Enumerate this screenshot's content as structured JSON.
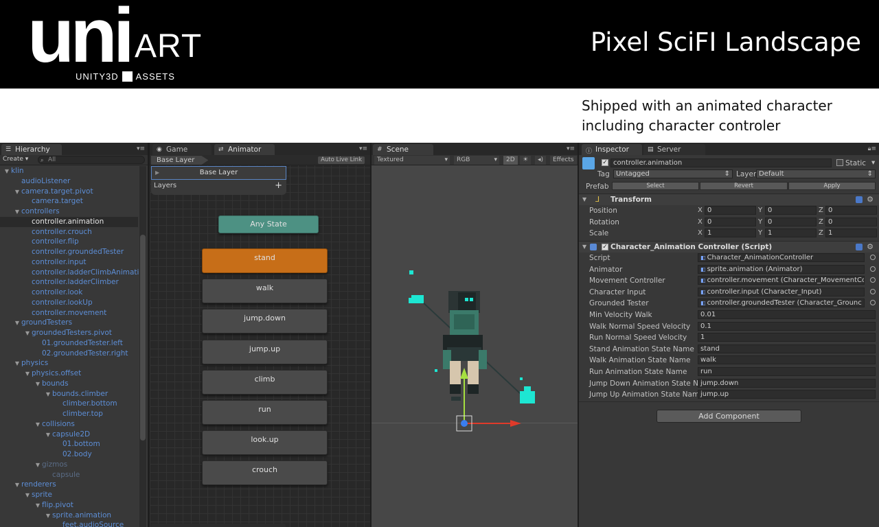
{
  "banner": {
    "logo_main": "uni",
    "logo_art": "ART",
    "logo_left": "UNITY3D",
    "logo_right": "ASSETS",
    "title": "Pixel SciFI Landscape"
  },
  "tagline": {
    "line1": "Shipped with an animated character",
    "line2": "including character controler"
  },
  "hierarchy": {
    "tab": "Hierarchy",
    "create": "Create ▾",
    "search_placeholder": "All",
    "items": [
      {
        "label": "klin",
        "depth": 0,
        "arrow": true
      },
      {
        "label": "audioListener",
        "depth": 1,
        "arrow": false
      },
      {
        "label": "camera.target.pivot",
        "depth": 1,
        "arrow": true
      },
      {
        "label": "camera.target",
        "depth": 2,
        "arrow": false
      },
      {
        "label": "controllers",
        "depth": 1,
        "arrow": true
      },
      {
        "label": "controller.animation",
        "depth": 2,
        "arrow": false,
        "selected": true
      },
      {
        "label": "controller.crouch",
        "depth": 2,
        "arrow": false
      },
      {
        "label": "controller.flip",
        "depth": 2,
        "arrow": false
      },
      {
        "label": "controller.groundedTester",
        "depth": 2,
        "arrow": false
      },
      {
        "label": "controller.input",
        "depth": 2,
        "arrow": false
      },
      {
        "label": "controller.ladderClimbAnimatio",
        "depth": 2,
        "arrow": false
      },
      {
        "label": "controller.ladderClimber",
        "depth": 2,
        "arrow": false
      },
      {
        "label": "controller.look",
        "depth": 2,
        "arrow": false
      },
      {
        "label": "controller.lookUp",
        "depth": 2,
        "arrow": false
      },
      {
        "label": "controller.movement",
        "depth": 2,
        "arrow": false
      },
      {
        "label": "groundTesters",
        "depth": 1,
        "arrow": true
      },
      {
        "label": "groundedTesters.pivot",
        "depth": 2,
        "arrow": true
      },
      {
        "label": "01.groundedTester.left",
        "depth": 3,
        "arrow": false
      },
      {
        "label": "02.groundedTester.right",
        "depth": 3,
        "arrow": false
      },
      {
        "label": "physics",
        "depth": 1,
        "arrow": true
      },
      {
        "label": "physics.offset",
        "depth": 2,
        "arrow": true
      },
      {
        "label": "bounds",
        "depth": 3,
        "arrow": true
      },
      {
        "label": "bounds.climber",
        "depth": 4,
        "arrow": true
      },
      {
        "label": "climber.bottom",
        "depth": 5,
        "arrow": false
      },
      {
        "label": "climber.top",
        "depth": 5,
        "arrow": false
      },
      {
        "label": "collisions",
        "depth": 3,
        "arrow": true
      },
      {
        "label": "capsule2D",
        "depth": 4,
        "arrow": true
      },
      {
        "label": "01.bottom",
        "depth": 5,
        "arrow": false
      },
      {
        "label": "02.body",
        "depth": 5,
        "arrow": false
      },
      {
        "label": "gizmos",
        "depth": 3,
        "arrow": true,
        "dim": true
      },
      {
        "label": "capsule",
        "depth": 4,
        "arrow": false,
        "dim": true
      },
      {
        "label": "renderers",
        "depth": 1,
        "arrow": true
      },
      {
        "label": "sprite",
        "depth": 2,
        "arrow": true
      },
      {
        "label": "flip.pivot",
        "depth": 3,
        "arrow": true
      },
      {
        "label": "sprite.animation",
        "depth": 4,
        "arrow": true
      },
      {
        "label": "feet.audioSource",
        "depth": 5,
        "arrow": false
      }
    ]
  },
  "animator": {
    "tab_game": "Game",
    "tab_animator": "Animator",
    "breadcrumb": "Base Layer",
    "auto_live_link": "Auto Live Link",
    "layer_name": "Base Layer",
    "layers_label": "Layers",
    "any_state": "Any State",
    "states": [
      "stand",
      "walk",
      "jump.down",
      "jump.up",
      "climb",
      "run",
      "look.up",
      "crouch"
    ],
    "active_state": "stand"
  },
  "scene": {
    "tab": "Scene",
    "shading": "Textured",
    "color_mode": "RGB",
    "mode_2d": "2D",
    "effects": "Effects"
  },
  "inspector": {
    "tab": "Inspector",
    "tab_server": "Server",
    "object_name": "controller.animation",
    "static_label": "Static",
    "tag_label": "Tag",
    "tag_value": "Untagged",
    "layer_label": "Layer",
    "layer_value": "Default",
    "prefab_label": "Prefab",
    "prefab_select": "Select",
    "prefab_revert": "Revert",
    "prefab_apply": "Apply",
    "transform": {
      "title": "Transform",
      "rows": [
        {
          "label": "Position",
          "x": "0",
          "y": "0",
          "z": "0"
        },
        {
          "label": "Rotation",
          "x": "0",
          "y": "0",
          "z": "0"
        },
        {
          "label": "Scale",
          "x": "1",
          "y": "1",
          "z": "1"
        }
      ]
    },
    "script_component": {
      "title": "Character_Animation Controller (Script)",
      "fields": [
        {
          "label": "Script",
          "value": "Character_AnimationController",
          "ref": true
        },
        {
          "label": "Animator",
          "value": "sprite.animation (Animator)",
          "ref": true
        },
        {
          "label": "Movement Controller",
          "value": "controller.movement (Character_MovementCo",
          "ref": true
        },
        {
          "label": "Character Input",
          "value": "controller.input (Character_Input)",
          "ref": true
        },
        {
          "label": "Grounded Tester",
          "value": "controller.groundedTester (Character_Grounc",
          "ref": true
        },
        {
          "label": "Min Velocity Walk",
          "value": "0.01",
          "ref": false
        },
        {
          "label": "Walk Normal Speed Velocity",
          "value": "0.1",
          "ref": false
        },
        {
          "label": "Run Normal Speed Velocity",
          "value": "1",
          "ref": false
        },
        {
          "label": "Stand Animation State Name",
          "value": "stand",
          "ref": false
        },
        {
          "label": "Walk Animation State Name",
          "value": "walk",
          "ref": false
        },
        {
          "label": "Run Animation State Name",
          "value": "run",
          "ref": false
        },
        {
          "label": "Jump Down Animation State Nan",
          "value": "jump.down",
          "ref": false
        },
        {
          "label": "Jump Up Animation State Name",
          "value": "jump.up",
          "ref": false
        }
      ]
    },
    "add_component": "Add Component"
  },
  "colors": {
    "any_state": "#4d9183",
    "active_state": "#c76e18",
    "hierarchy_text": "#5d8ed6",
    "character_glow": "#1de6d2"
  }
}
